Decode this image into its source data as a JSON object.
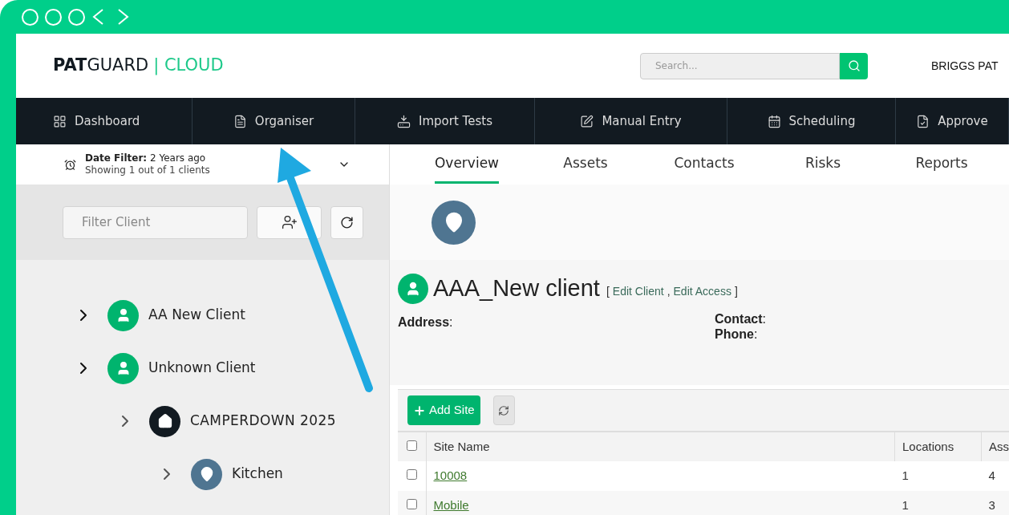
{
  "header": {
    "logo": "**PAT**GUARD",
    "logo_accent": "| CLOUD",
    "search": {
      "placeholder": "Search..."
    },
    "user": "BRIGGS PAT"
  },
  "nav": [
    {
      "kind": "dashboard",
      "label": "Dashboard"
    },
    {
      "kind": "organiser",
      "label": "Organiser"
    },
    {
      "kind": "import",
      "label": "Import Tests"
    },
    {
      "kind": "manual",
      "label": "Manual Entry"
    },
    {
      "kind": "scheduling",
      "label": "Scheduling"
    },
    {
      "kind": "approved",
      "label": "Approve"
    }
  ],
  "sidebar": {
    "date_filter": {
      "text": "**Date Filter:** 2 Years ago",
      "summary": "Showing 1 out of 1 clients"
    },
    "filter": {
      "placeholder": "Filter Client"
    },
    "tree": [
      {
        "kind": "client",
        "label": "AA New Client"
      },
      {
        "kind": "client",
        "label": "Unknown Client",
        "children": [
          {
            "kind": "site",
            "label": "CAMPERDOWN 2025",
            "children": [
              {
                "kind": "location",
                "label": "Kitchen"
              }
            ]
          }
        ]
      }
    ]
  },
  "tabs": [
    {
      "label": "Overview",
      "selected": true
    },
    {
      "label": "Assets",
      "selected": false
    },
    {
      "label": "Contacts",
      "selected": false
    },
    {
      "label": "Risks",
      "selected": false
    },
    {
      "label": "Reports",
      "selected": false
    }
  ],
  "client": {
    "name": "AAA_New client",
    "link_open": "[",
    "links": [
      "Edit Client",
      "Edit Access"
    ],
    "link_separator": ",",
    "link_close": "]",
    "address": "**Address**:",
    "contact": "**Contact**:",
    "phone": "**Phone**:"
  },
  "sites": {
    "add_button": "Add Site",
    "header_checked": false,
    "columns": [
      "Site Name",
      "Locations",
      "Ass"
    ],
    "rows": [
      {
        "checked": false,
        "cells": [
          "10008",
          "1",
          "4"
        ]
      },
      {
        "checked": false,
        "cells": [
          "Mobile",
          "1",
          "3"
        ]
      }
    ]
  }
}
